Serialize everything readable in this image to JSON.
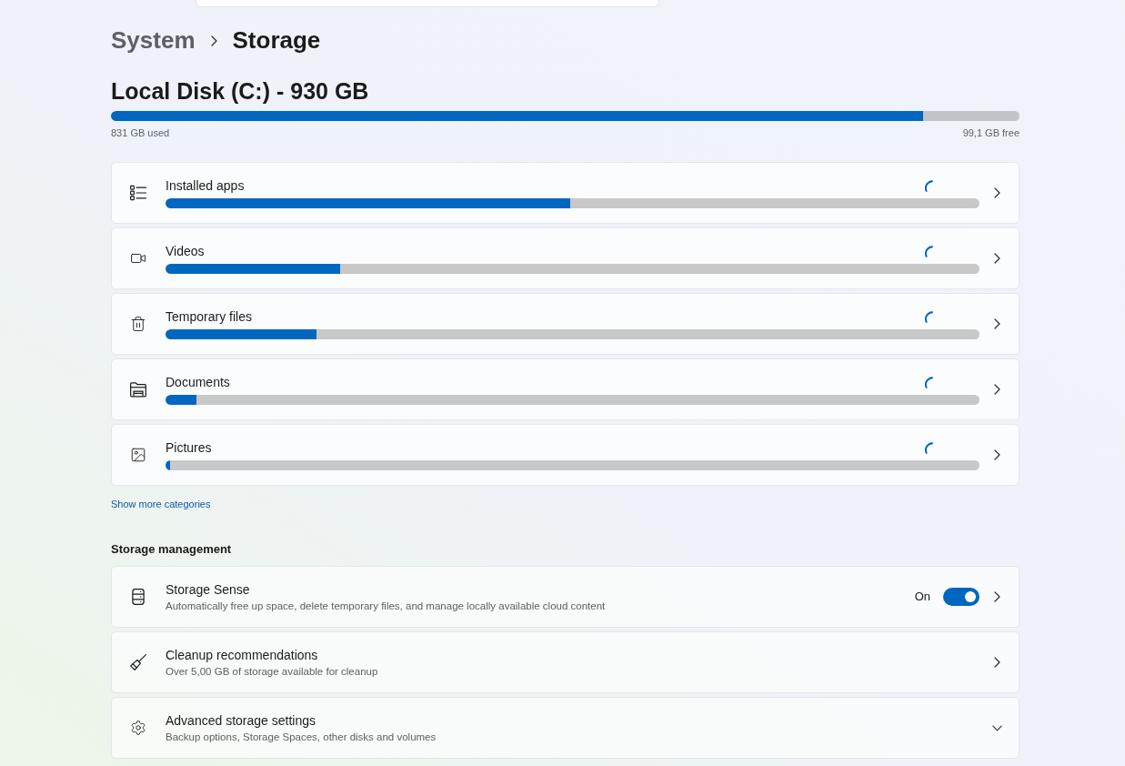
{
  "breadcrumb": {
    "parent": "System",
    "current": "Storage"
  },
  "disk": {
    "title": "Local Disk (C:) - 930 GB",
    "level": 0.894,
    "used": "831 GB used",
    "free": "99,1 GB free"
  },
  "categories": [
    {
      "label": "Installed apps",
      "level": 0.497,
      "loading": true
    },
    {
      "label": "Videos",
      "level": 0.214,
      "loading": true
    },
    {
      "label": "Temporary files",
      "level": 0.185,
      "loading": true
    },
    {
      "label": "Documents",
      "level": 0.038,
      "loading": true
    },
    {
      "label": "Pictures",
      "level": 0.006,
      "loading": true
    }
  ],
  "show_more_link": "Show more categories",
  "storage_management": {
    "heading": "Storage management",
    "items": [
      {
        "kind": "toggle",
        "title": "Storage Sense",
        "description": "Automatically free up space, delete temporary files, and manage locally available cloud content",
        "toggle": {
          "label": "On",
          "on": true
        }
      },
      {
        "kind": "link",
        "title": "Cleanup recommendations",
        "description": "Over 5,00 GB of storage available for cleanup"
      },
      {
        "kind": "expander",
        "title": "Advanced storage settings",
        "description": "Backup options, Storage Spaces, other disks and volumes",
        "expanded": false
      }
    ]
  }
}
